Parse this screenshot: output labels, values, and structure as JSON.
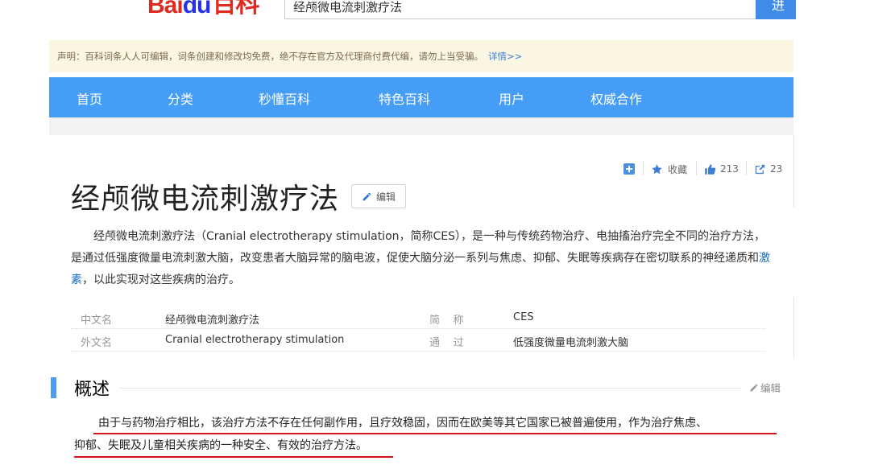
{
  "header": {
    "logo_text_a": "Bai",
    "logo_text_b": "du",
    "logo_text_c": "百科",
    "search_value": "经颅微电流刺激疗法",
    "search_button": "进入"
  },
  "notice": {
    "text": "声明：百科词条人人可编辑，词条创建和修改均免费，绝不存在官方及代理商付费代编，请勿上当受骗。",
    "detail_link": "详情>>"
  },
  "nav": {
    "items": [
      "首页",
      "分类",
      "秒懂百科",
      "特色百科",
      "用户",
      "权威合作"
    ]
  },
  "tools": {
    "favorite_label": "收藏",
    "likes": "213",
    "shares": "23"
  },
  "entry": {
    "title": "经颅微电流刺激疗法",
    "edit_label": "编辑",
    "intro_part1": "经颅微电流刺激疗法（Cranial electrotherapy stimulation，简称CES），是一种与传统药物治疗、电抽搐治疗完全不同的治疗方法，是通过低强度微量电流刺激大脑，改变患者大脑异常的脑电波，促使大脑分泌一系列与焦虑、抑郁、失眠等疾病存在密切联系的神经递质和",
    "intro_link": "激素",
    "intro_part2": "，以此实现对这些疾病的治疗。"
  },
  "basic_info": [
    {
      "k1": "中文名",
      "v1": "经颅微电流刺激疗法",
      "k2": "简    称",
      "v2": "CES"
    },
    {
      "k1": "外文名",
      "v1": "Cranial electrotherapy stimulation",
      "k2": "通    过",
      "v2": "低强度微量电流刺激大脑"
    }
  ],
  "section": {
    "title": "概述",
    "edit_label": "编辑",
    "line1": "由于与药物治疗相比，该治疗方法不存在任何副作用，且疗效稳固，因而在欧美等其它国家已被普遍使用，作为治疗焦虑、",
    "line2": "抑郁、失眠及儿童相关疾病的一种安全、有效的治疗方法。"
  },
  "colors": {
    "nav_bg": "#459df5",
    "notice_bg": "#fbf6e1",
    "annotation_red": "#d9141c",
    "section_accent": "#4f9cee"
  }
}
